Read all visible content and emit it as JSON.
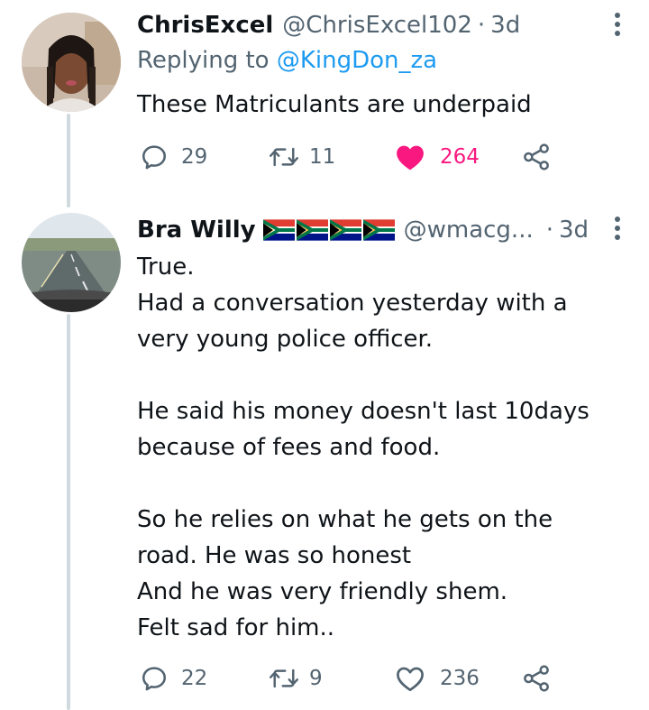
{
  "tweets": [
    {
      "name": "ChrisExcel",
      "handle": "@ChrisExcel102",
      "dot": "·",
      "time": "3d",
      "replying_prefix": "Replying to ",
      "replying_mention": "@KingDon_za",
      "text": "These Matriculants are underpaid",
      "replies": "29",
      "retweets": "11",
      "likes": "264",
      "liked": true,
      "avatar_icon": "profile-photo-woman"
    },
    {
      "name": "Bra Willy",
      "flags_icon": "south-africa-flag",
      "flag_count": 4,
      "handle": "@wmacg...",
      "dot": "·",
      "time": "3d",
      "text": "True.\nHad a conversation yesterday with a\nvery young police officer.\n\nHe said his money doesn't last 10days\nbecause of fees and food.\n\nSo he relies on what he gets on the\nroad. He was so honest\nAnd he was very friendly shem.\nFelt sad for him..",
      "replies": "22",
      "retweets": "9",
      "likes": "236",
      "liked": false,
      "avatar_icon": "profile-photo-road"
    }
  ],
  "colors": {
    "text": "#0f1419",
    "secondary": "#536471",
    "link": "#1d9bf0",
    "like_active": "#f91880",
    "thread_line": "#cfd9de"
  }
}
